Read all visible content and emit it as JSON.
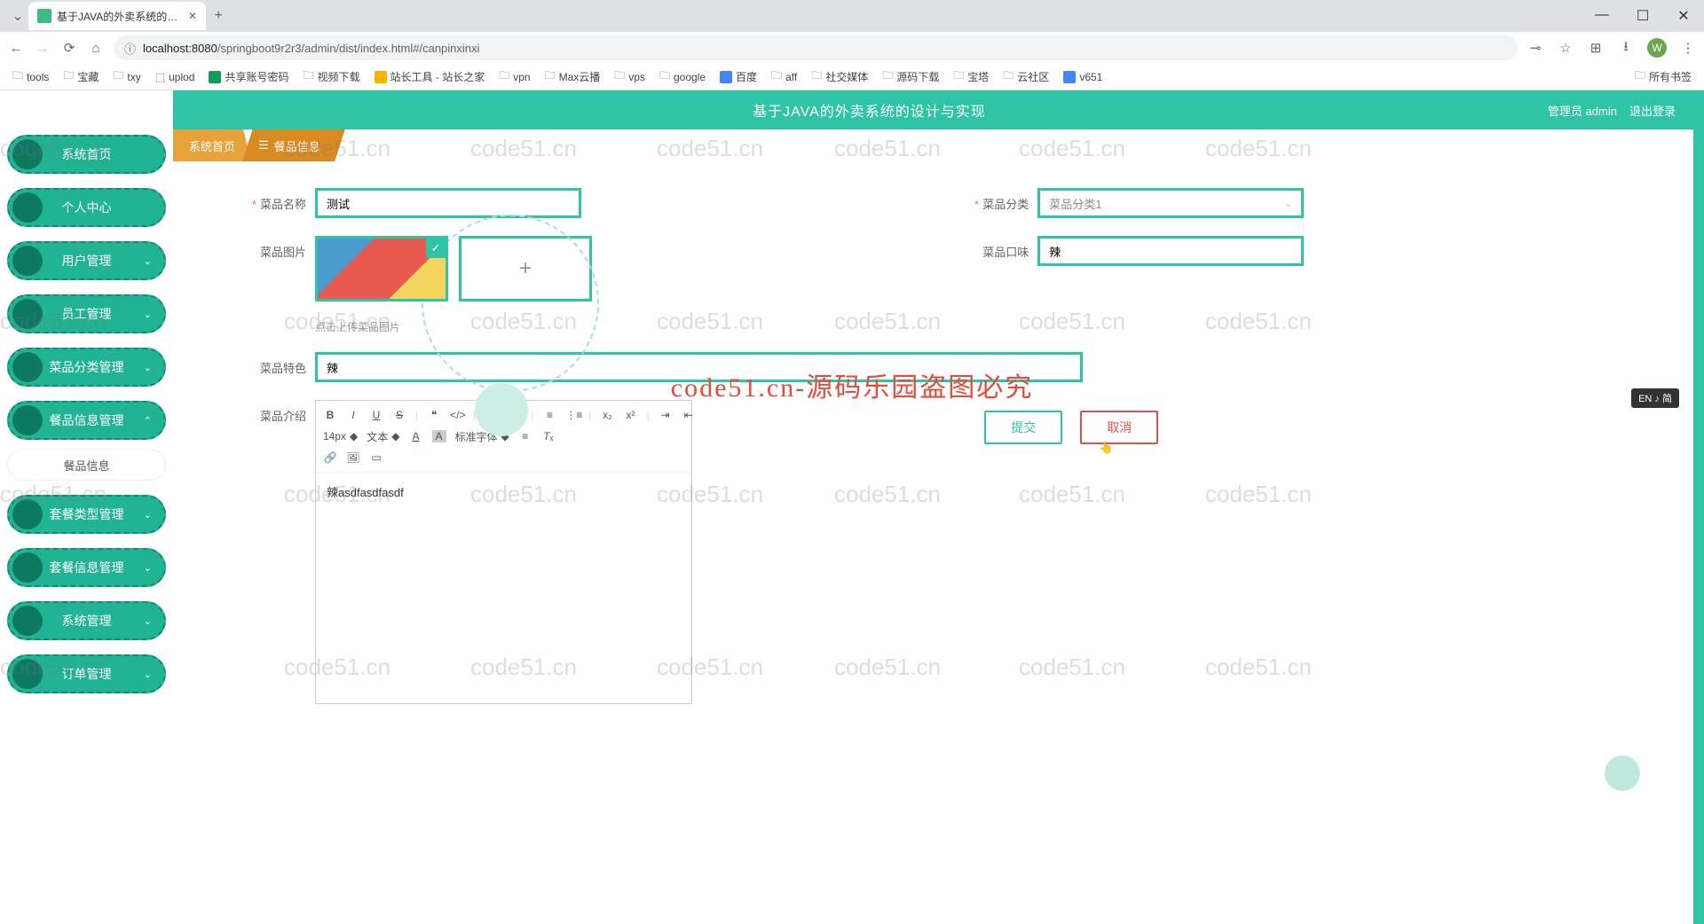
{
  "browser": {
    "tab_title": "基于JAVA的外卖系统的设计与",
    "url_prefix": "localhost:8080",
    "url_path": "/springboot9r2r3/admin/dist/index.html#/canpinxinxi",
    "bookmarks": [
      "tools",
      "宝藏",
      "txy",
      "uplod",
      "共享账号密码",
      "视频下载",
      "站长工具 - 站长之家",
      "vpn",
      "Max云播",
      "vps",
      "google",
      "百度",
      "aff",
      "社交媒体",
      "源码下载",
      "宝塔",
      "云社区",
      "v651"
    ],
    "all_bookmarks": "所有书签"
  },
  "header": {
    "title": "基于JAVA的外卖系统的设计与实现",
    "admin_label": "管理员 admin",
    "logout": "退出登录"
  },
  "tabs": {
    "home": "系统首页",
    "current": "餐品信息"
  },
  "sidebar": {
    "items": [
      {
        "label": "系统首页",
        "expandable": false
      },
      {
        "label": "个人中心",
        "expandable": false
      },
      {
        "label": "用户管理",
        "expandable": true
      },
      {
        "label": "员工管理",
        "expandable": true
      },
      {
        "label": "菜品分类管理",
        "expandable": true
      },
      {
        "label": "餐品信息管理",
        "expandable": true,
        "active": true
      },
      {
        "label": "套餐类型管理",
        "expandable": true
      },
      {
        "label": "套餐信息管理",
        "expandable": true
      },
      {
        "label": "系统管理",
        "expandable": true
      },
      {
        "label": "订单管理",
        "expandable": true
      }
    ],
    "sub_item": "餐品信息"
  },
  "form": {
    "name_label": "菜品名称",
    "name_value": "测试",
    "category_label": "菜品分类",
    "category_value": "菜品分类1",
    "image_label": "菜品图片",
    "taste_label": "菜品口味",
    "taste_value": "辣",
    "upload_hint": "点击上传菜品图片",
    "feature_label": "菜品特色",
    "feature_value": "辣",
    "intro_label": "菜品介绍",
    "intro_content": "辣asdfasdfasdf",
    "submit": "提交",
    "cancel": "取消"
  },
  "editor": {
    "font_size": "14px",
    "text_type": "文本",
    "font_family": "标准字体"
  },
  "watermark": {
    "text": "code51.cn",
    "center": "code51.cn-源码乐园盗图必究"
  },
  "ime": "EN ♪ 简"
}
